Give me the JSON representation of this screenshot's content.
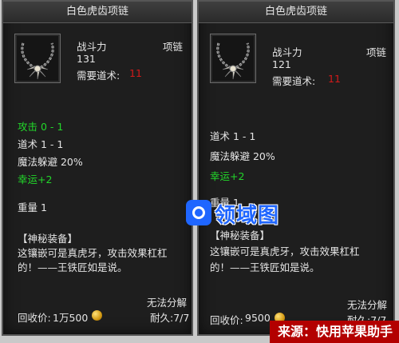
{
  "panels": [
    {
      "title": "白色虎齿项链",
      "stat_label": "战斗力",
      "stat_value": "131",
      "item_type": "项链",
      "req_label": "需要道术:",
      "req_value": "11",
      "attack": "攻击 0 - 1",
      "taoism": "道术 1 - 1",
      "magic_evade": "魔法躲避 20%",
      "luck": "幸运+2",
      "weight": "重量 1",
      "tag": "【神秘装备】",
      "desc_line1": "这镶嵌可是真虎牙，攻击效果杠杠",
      "desc_line2": "的！——王铁匠如是说。",
      "no_dismantle": "无法分解",
      "recycle_label": "回收价:",
      "recycle_value": "1万500",
      "durability": "耐久:7/7"
    },
    {
      "title": "白色虎齿项链",
      "stat_label": "战斗力",
      "stat_value": "121",
      "item_type": "项链",
      "req_label": "需要道术:",
      "req_value": "11",
      "taoism": "道术 1 - 1",
      "magic_evade": "魔法躲避 20%",
      "luck": "幸运+2",
      "weight": "重量 1",
      "tag": "【神秘装备】",
      "desc_line1": "这镶嵌可是真虎牙，攻击效果杠杠",
      "desc_line2": "的！——王铁匠如是说。",
      "no_dismantle": "无法分解",
      "recycle_label": "回收价:",
      "recycle_value": "9500",
      "durability": "耐久:7/7"
    }
  ],
  "watermark": {
    "logo_text": "领域图",
    "source_caption": "来源：快用苹果助手"
  },
  "colors": {
    "green": "#22d62a",
    "red": "#d31a1a",
    "panel_bg": "#1e1e1e",
    "watermark_blue": "#1f66ff"
  },
  "icons": {
    "item": "tiger-tooth-necklace-icon",
    "coin": "gold-coin-icon"
  }
}
